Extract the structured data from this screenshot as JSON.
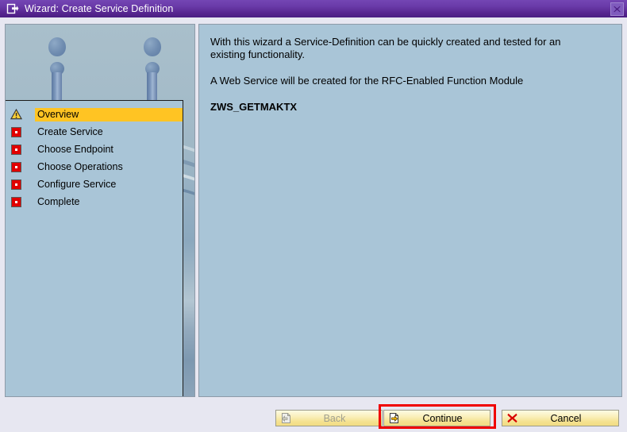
{
  "window": {
    "title": "Wizard: Create Service Definition",
    "title_icon": "window-wizard-icon",
    "close_icon": "close-icon",
    "titlebar_gradient_top": "#7446b4",
    "titlebar_gradient_bottom": "#4a1e82",
    "dialog_background": "#e7e7f1"
  },
  "sidebar": {
    "artwork_name": "water-droplet-ripple-graphic",
    "highlight_color": "#ffc423",
    "panel_background": "#a9c6d8",
    "steps": [
      {
        "label": "Overview",
        "icon": "warning-triangle-icon",
        "state": "current"
      },
      {
        "label": "Create Service",
        "icon": "red-square-icon",
        "state": "pending"
      },
      {
        "label": "Choose Endpoint",
        "icon": "red-square-icon",
        "state": "pending"
      },
      {
        "label": "Choose Operations",
        "icon": "red-square-icon",
        "state": "pending"
      },
      {
        "label": "Configure Service",
        "icon": "red-square-icon",
        "state": "pending"
      },
      {
        "label": "Complete",
        "icon": "red-square-icon",
        "state": "pending"
      }
    ]
  },
  "content": {
    "paragraph_1": "With this wizard a Service-Definition can be quickly created and tested for an existing functionality.",
    "paragraph_2": "A Web Service will be created for the RFC-Enabled Function Module",
    "function_module": "ZWS_GETMAKTX"
  },
  "footer": {
    "back": {
      "label": "Back",
      "icon": "page-back-arrow-icon",
      "enabled": false
    },
    "continue": {
      "label": "Continue",
      "icon": "page-forward-arrow-icon",
      "enabled": true,
      "highlighted": true,
      "highlight_color": "#f00000"
    },
    "cancel": {
      "label": "Cancel",
      "icon": "red-x-icon",
      "enabled": true
    }
  }
}
